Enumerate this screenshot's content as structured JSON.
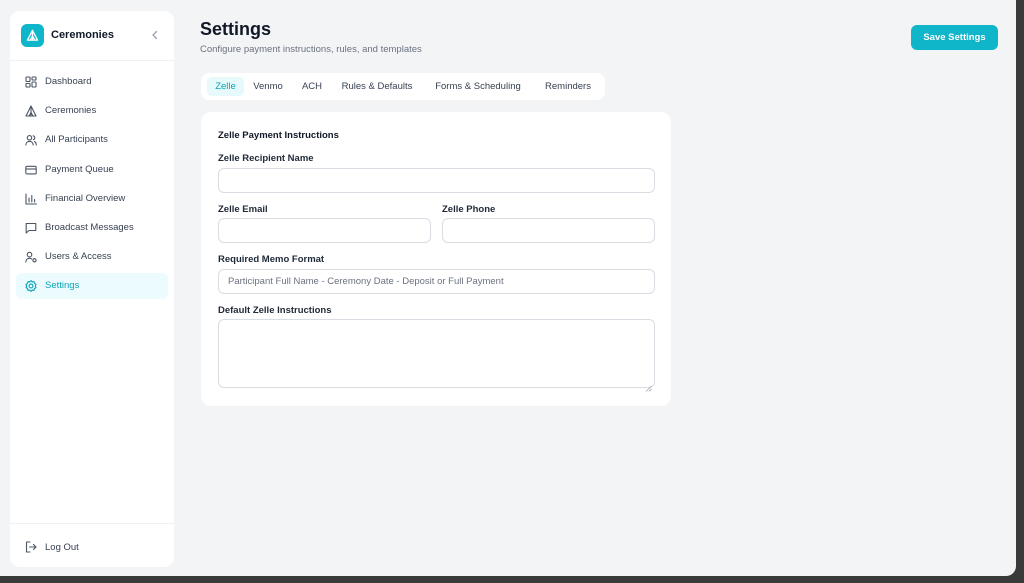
{
  "sidebar": {
    "brand_title": "Ceremonies",
    "items": [
      {
        "label": "Dashboard",
        "icon": "grid-icon"
      },
      {
        "label": "Ceremonies",
        "icon": "ceremony-icon"
      },
      {
        "label": "All Participants",
        "icon": "users-icon"
      },
      {
        "label": "Payment Queue",
        "icon": "credit-card-icon"
      },
      {
        "label": "Financial Overview",
        "icon": "bar-chart-icon"
      },
      {
        "label": "Broadcast Messages",
        "icon": "message-icon"
      },
      {
        "label": "Users & Access",
        "icon": "user-settings-icon"
      },
      {
        "label": "Settings",
        "icon": "gear-icon",
        "active": true
      }
    ],
    "logout_label": "Log Out"
  },
  "header": {
    "title": "Settings",
    "subtitle": "Configure payment instructions, rules, and templates",
    "save_label": "Save Settings"
  },
  "tabs": [
    {
      "label": "Zelle",
      "active": true
    },
    {
      "label": "Venmo"
    },
    {
      "label": "ACH"
    },
    {
      "label": "Rules & Defaults"
    },
    {
      "label": "Forms & Scheduling"
    },
    {
      "label": "Reminders"
    }
  ],
  "form": {
    "section_title": "Zelle Payment Instructions",
    "recipient_name_label": "Zelle Recipient Name",
    "recipient_name_value": "",
    "email_label": "Zelle Email",
    "email_value": "",
    "phone_label": "Zelle Phone",
    "phone_value": "",
    "memo_label": "Required Memo Format",
    "memo_placeholder": "Participant Full Name - Ceremony Date - Deposit or Full Payment",
    "instructions_label": "Default Zelle Instructions",
    "instructions_value": ""
  },
  "colors": {
    "accent": "#0fb5c9",
    "active_bg": "#ecfbfd",
    "page_bg": "#f3f4f6"
  }
}
